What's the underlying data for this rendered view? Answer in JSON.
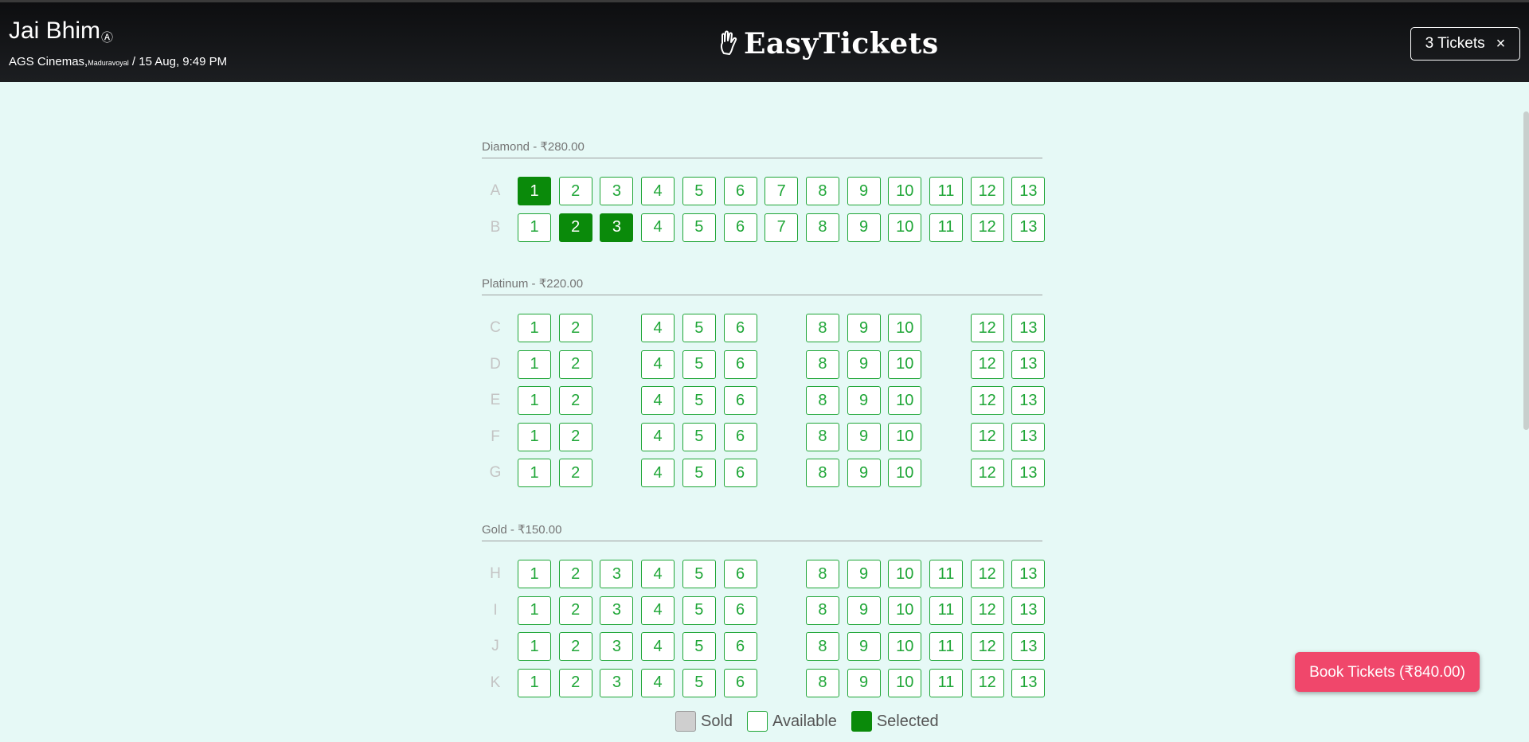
{
  "header": {
    "movie_title": "Jai Bhim",
    "rating": "Ⓐ",
    "venue_name": "AGS Cinemas,",
    "venue_location": "Maduravoyal",
    "showtime": " / 15 Aug, 9:49 PM",
    "brand": "EasyTickets",
    "ticket_count_label": "3 Tickets",
    "close_glyph": "×"
  },
  "sections": [
    {
      "label": "Diamond - ₹280.00",
      "rows": [
        {
          "letter": "A",
          "seats": [
            1,
            2,
            3,
            4,
            5,
            6,
            7,
            8,
            9,
            10,
            11,
            12,
            13
          ],
          "selected": [
            1
          ]
        },
        {
          "letter": "B",
          "seats": [
            1,
            2,
            3,
            4,
            5,
            6,
            7,
            8,
            9,
            10,
            11,
            12,
            13
          ],
          "selected": [
            2,
            3
          ]
        }
      ]
    },
    {
      "label": "Platinum - ₹220.00",
      "rows": [
        {
          "letter": "C",
          "seats": [
            1,
            2,
            4,
            5,
            6,
            8,
            9,
            10,
            12,
            13
          ],
          "selected": []
        },
        {
          "letter": "D",
          "seats": [
            1,
            2,
            4,
            5,
            6,
            8,
            9,
            10,
            12,
            13
          ],
          "selected": []
        },
        {
          "letter": "E",
          "seats": [
            1,
            2,
            4,
            5,
            6,
            8,
            9,
            10,
            12,
            13
          ],
          "selected": []
        },
        {
          "letter": "F",
          "seats": [
            1,
            2,
            4,
            5,
            6,
            8,
            9,
            10,
            12,
            13
          ],
          "selected": []
        },
        {
          "letter": "G",
          "seats": [
            1,
            2,
            4,
            5,
            6,
            8,
            9,
            10,
            12,
            13
          ],
          "selected": []
        }
      ]
    },
    {
      "label": "Gold - ₹150.00",
      "rows": [
        {
          "letter": "H",
          "seats": [
            1,
            2,
            3,
            4,
            5,
            6,
            8,
            9,
            10,
            11,
            12,
            13
          ],
          "selected": []
        },
        {
          "letter": "I",
          "seats": [
            1,
            2,
            3,
            4,
            5,
            6,
            8,
            9,
            10,
            11,
            12,
            13
          ],
          "selected": []
        },
        {
          "letter": "J",
          "seats": [
            1,
            2,
            3,
            4,
            5,
            6,
            8,
            9,
            10,
            11,
            12,
            13
          ],
          "selected": []
        },
        {
          "letter": "K",
          "seats": [
            1,
            2,
            3,
            4,
            5,
            6,
            8,
            9,
            10,
            11,
            12,
            13
          ],
          "selected": []
        }
      ]
    }
  ],
  "legend": {
    "sold": "Sold",
    "available": "Available",
    "selected": "Selected"
  },
  "book_button": "Book Tickets (₹840.00)",
  "colors": {
    "available": "#1fa637",
    "selected": "#0a8a0a",
    "sold": "#cfcfcf",
    "book_button": "#f0476b"
  }
}
